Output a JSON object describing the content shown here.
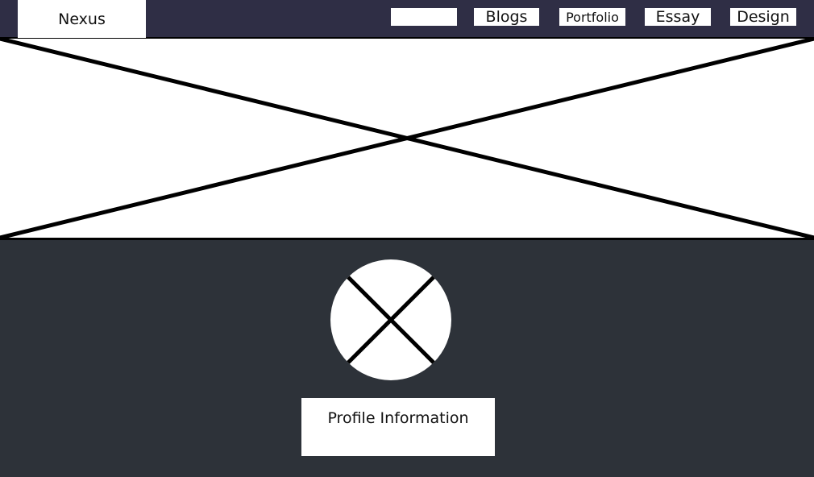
{
  "header": {
    "logo_text": "Nexus",
    "nav": {
      "blank_label": "",
      "blogs_label": "Blogs",
      "portfolio_label": "Portfolio",
      "essay_label": "Essay",
      "design_label": "Design"
    }
  },
  "hero": {
    "icon": "image-placeholder-icon"
  },
  "profile": {
    "avatar_icon": "avatar-placeholder-icon",
    "info_label": "Profile Information"
  },
  "colors": {
    "topbar_bg": "#2f2e45",
    "page_bg": "#2d3239",
    "box_bg": "#ffffff",
    "line": "#000000"
  }
}
